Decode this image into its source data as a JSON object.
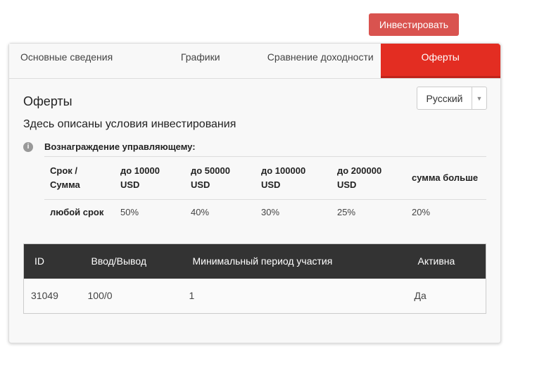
{
  "invest_button": "Инвестировать",
  "tabs": [
    "Основные сведения",
    "Графики",
    "Сравнение доходности",
    "Оферты"
  ],
  "title": "Оферты",
  "language": "Русский",
  "description": "Здесь описаны условия инвестирования",
  "reward_label": "Вознаграждение управляющему:",
  "reward_table": {
    "headers": [
      "Срок / Сумма",
      "до 10000 USD",
      "до 50000 USD",
      "до 100000 USD",
      "до 200000 USD",
      "сумма больше"
    ],
    "row": [
      "любой срок",
      "50%",
      "40%",
      "30%",
      "25%",
      "20%"
    ]
  },
  "offers_table": {
    "headers": [
      "ID",
      "Ввод/Вывод",
      "Минимальный период участия",
      "Активна"
    ],
    "row": [
      "31049",
      "100/0",
      "1",
      "Да"
    ]
  }
}
